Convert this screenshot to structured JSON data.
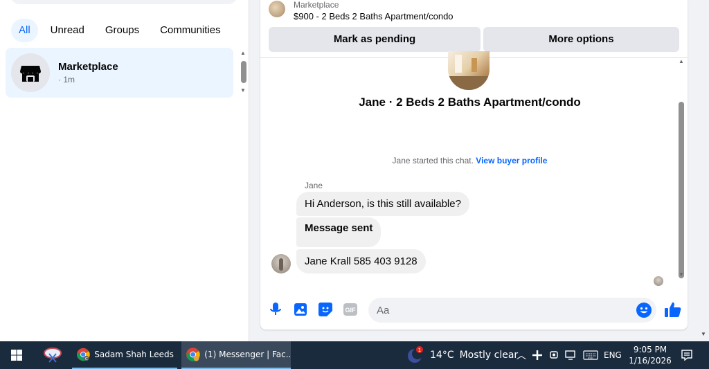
{
  "filters": [
    "All",
    "Unread",
    "Groups",
    "Communities"
  ],
  "conversation": {
    "title": "Marketplace",
    "time": "· 1m"
  },
  "header": {
    "source": "Marketplace",
    "listing": "$900 - 2 Beds 2 Baths Apartment/condo",
    "mark_pending": "Mark as pending",
    "more_options": "More options"
  },
  "chat": {
    "listing_title": "Jane · 2 Beds 2 Baths Apartment/condo",
    "started_text": "Jane started this chat.",
    "buyer_profile_link": "View buyer profile",
    "sender": "Jane",
    "messages": [
      "Hi Anderson, is this still available?",
      "Message sent",
      "Jane Krall 585 403 9128"
    ]
  },
  "composer": {
    "placeholder": "Aa",
    "value": ""
  },
  "taskbar": {
    "apps": [
      {
        "label": "Sadam Shah Leeds ...",
        "badge": "C"
      },
      {
        "label": "(1) Messenger | Fac..."
      }
    ],
    "weather": {
      "temp": "14°C",
      "condition": "Mostly clear",
      "badge": "1"
    },
    "language": "ENG",
    "time": "9:05 PM",
    "date": "1/16/2026"
  },
  "colors": {
    "accent": "#0866ff",
    "active_bg": "#ebf5ff",
    "bubble": "#f0f0f0",
    "taskbar": "#1b2b3e"
  }
}
